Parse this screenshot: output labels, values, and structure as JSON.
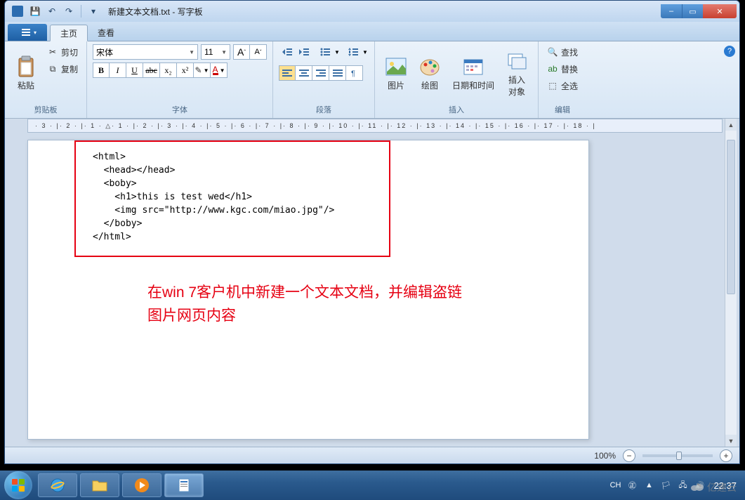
{
  "window": {
    "title": "新建文本文档.txt - 写字板",
    "controls": {
      "min": "–",
      "max": "▭",
      "close": "✕"
    }
  },
  "qat": {
    "save": "💾",
    "undo": "↶",
    "redo": "↷"
  },
  "tabs": {
    "file": "▾",
    "home": "主页",
    "view": "查看"
  },
  "ribbon": {
    "clipboard": {
      "label": "剪贴板",
      "paste": "粘贴",
      "cut": "剪切",
      "copy": "复制"
    },
    "font": {
      "label": "字体",
      "name": "宋体",
      "size": "11",
      "grow": "A",
      "shrink": "A",
      "bold": "B",
      "italic": "I",
      "underline": "U",
      "strike": "abc",
      "sub": "x₂",
      "sup": "x²",
      "highlight": "",
      "color": "A"
    },
    "paragraph": {
      "label": "段落"
    },
    "insert": {
      "label": "插入",
      "picture": "图片",
      "paint": "绘图",
      "datetime": "日期和时间",
      "object": "插入\n对象"
    },
    "editing": {
      "label": "编辑",
      "find": "查找",
      "replace": "替换",
      "select_all": "全选"
    }
  },
  "ruler_ticks": [
    "3",
    "2",
    "1",
    "1",
    "2",
    "3",
    "4",
    "5",
    "6",
    "7",
    "8",
    "9",
    "10",
    "11",
    "12",
    "13",
    "14",
    "15",
    "16",
    "17",
    "18"
  ],
  "document": {
    "code_lines": [
      "<html>",
      "  <head></head>",
      "  <boby>",
      "    <h1>this is test wed</h1>",
      "    <img src=\"http://www.kgc.com/miao.jpg\"/>",
      "  </boby>",
      "</html>"
    ],
    "annotation_l1": "在win 7客户机中新建一个文本文档，并编辑盗链",
    "annotation_l2": "图片网页内容"
  },
  "statusbar": {
    "zoom": "100%"
  },
  "taskbar": {
    "ime": "CH",
    "clock": "22:37"
  },
  "watermark": "亿速云"
}
